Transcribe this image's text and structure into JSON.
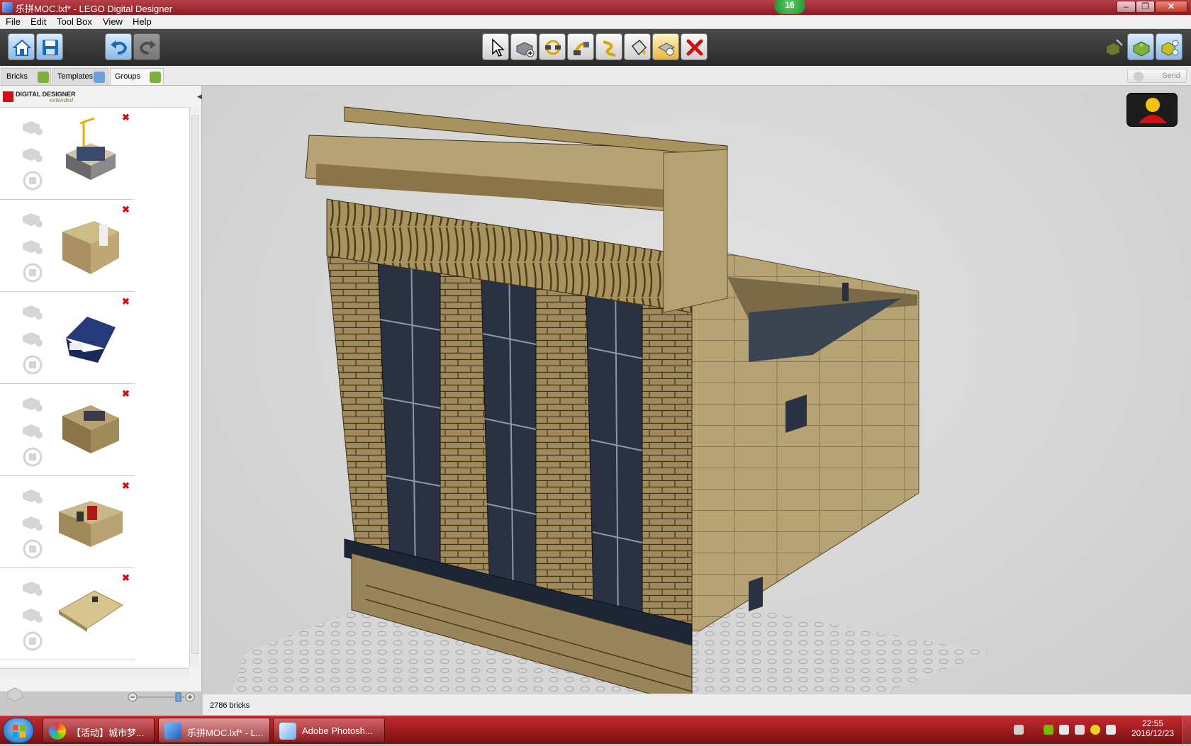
{
  "window": {
    "title": "乐拼MOC.lxf* - LEGO Digital Designer",
    "notification_badge": "16",
    "controls": {
      "minimize": "–",
      "maximize": "❐",
      "close": "✕"
    }
  },
  "menu": [
    "File",
    "Edit",
    "Tool Box",
    "View",
    "Help"
  ],
  "toolbar": {
    "left_tools": [
      "home-icon",
      "save-icon",
      "undo-icon",
      "redo-icon"
    ],
    "center_tools": [
      "select-cursor-icon",
      "add-brick-icon",
      "clone-icon",
      "hinge-icon",
      "flex-icon",
      "paint-bucket-icon",
      "hide-icon",
      "delete-icon"
    ],
    "right_tools": [
      "build-mode-icon",
      "view-mode-icon",
      "building-guide-icon"
    ]
  },
  "tabs": [
    {
      "label": "Bricks"
    },
    {
      "label": "Templates"
    },
    {
      "label": "Groups"
    }
  ],
  "send_label": "Send",
  "logo": {
    "line1": "DIGITAL DESIGNER",
    "line2": "extended"
  },
  "groups_count": 6,
  "status": {
    "brick_count": "2786 bricks"
  },
  "taskbar": {
    "items": [
      {
        "label": "【活动】城市梦..."
      },
      {
        "label": "乐拼MOC.lxf* - L..."
      },
      {
        "label": "Adobe Photosh..."
      }
    ],
    "time": "22:55",
    "date": "2016/12/23"
  },
  "colors": {
    "tan": "#b09a6c",
    "dark_tan": "#7d6b45",
    "window_glass": "#2a3142",
    "titlebar_red": "#a12a32",
    "accent_green": "#7db23a"
  }
}
